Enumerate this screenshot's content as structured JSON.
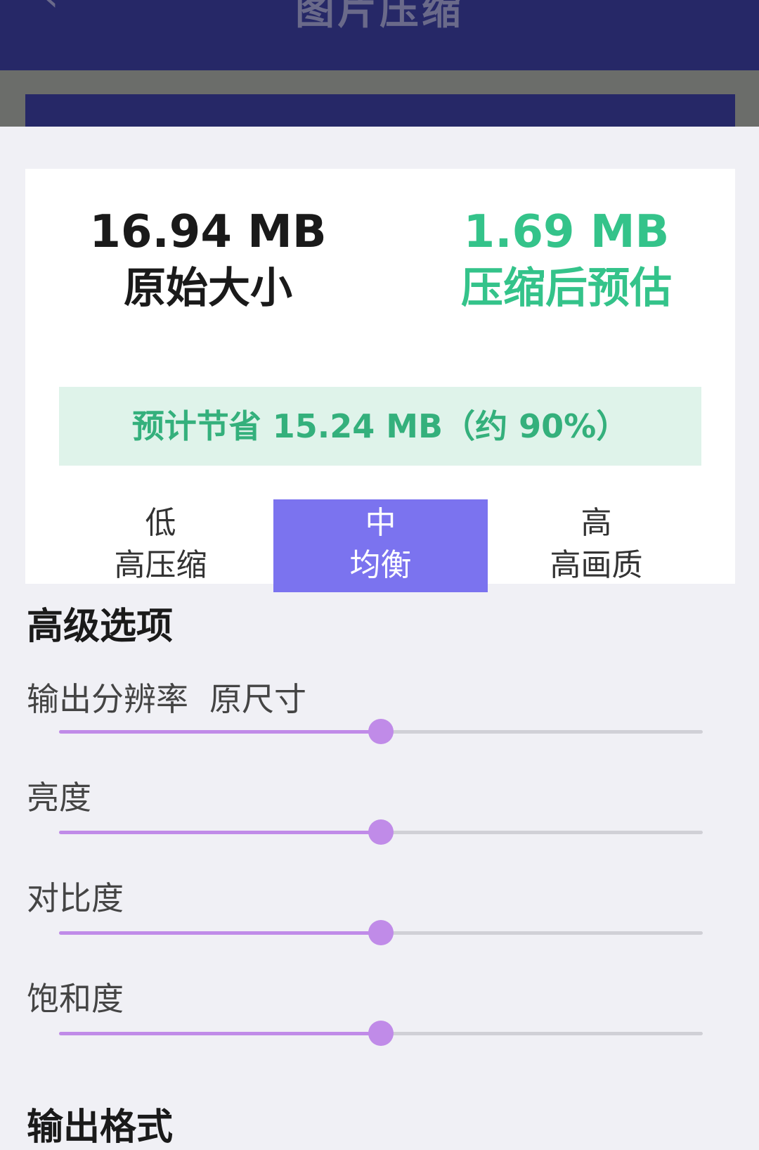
{
  "app_bar": {
    "title": "图片压缩"
  },
  "summary": {
    "original_size": "16.94 MB",
    "original_label": "原始大小",
    "compressed_size": "1.69 MB",
    "compressed_label": "压缩后预估",
    "savings_text": "预计节省 15.24 MB（约 90%）"
  },
  "quality_options": [
    {
      "title": "低",
      "subtitle": "高压缩",
      "selected": false
    },
    {
      "title": "中",
      "subtitle": "均衡",
      "selected": true
    },
    {
      "title": "高",
      "subtitle": "高画质",
      "selected": false
    }
  ],
  "advanced": {
    "title": "高级选项",
    "resolution": {
      "label": "输出分辨率",
      "value": "原尺寸",
      "level": 0.5
    },
    "brightness": {
      "label": "亮度",
      "level": 0.5
    },
    "contrast": {
      "label": "对比度",
      "level": 0.5
    },
    "saturation": {
      "label": "饱和度",
      "level": 0.5
    }
  },
  "output_format": {
    "title": "输出格式"
  },
  "colors": {
    "app_bar": "#262867",
    "accent": "#7b73ef",
    "green": "#34c38a",
    "slider": "#c08be8"
  }
}
